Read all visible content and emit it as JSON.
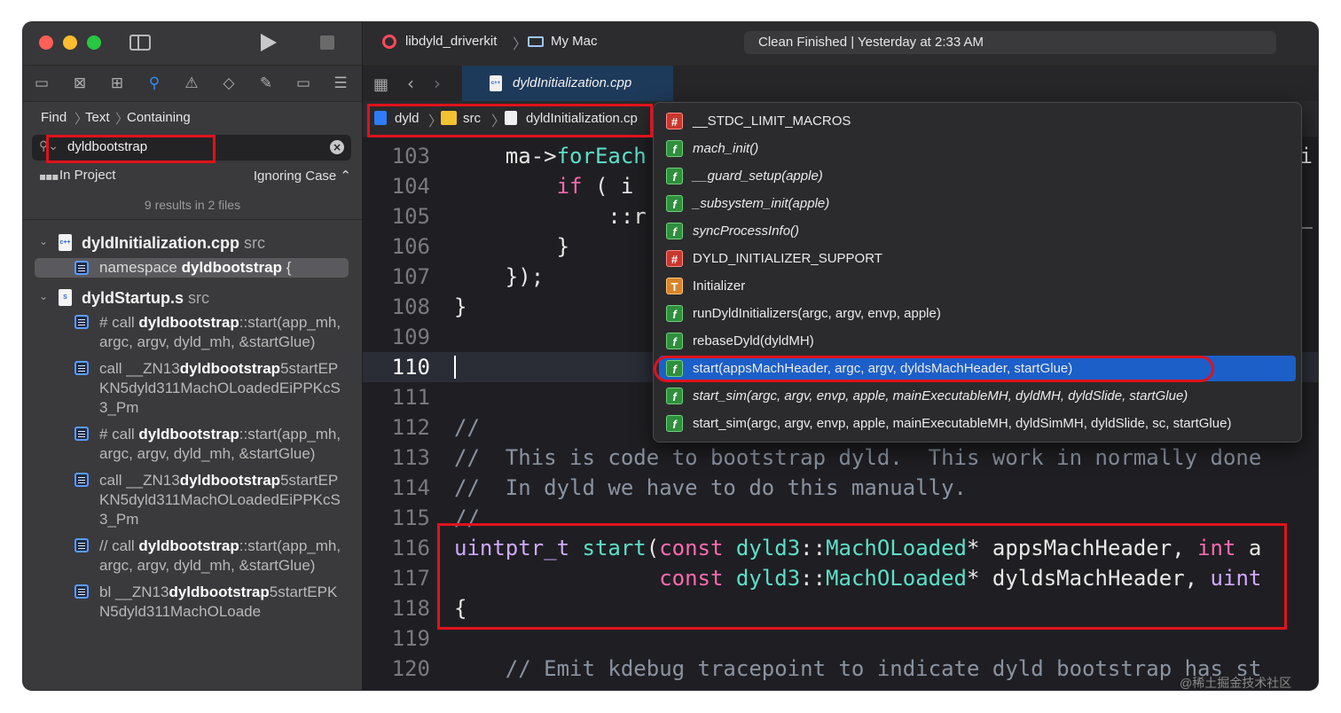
{
  "toolbar": {
    "scheme": "libdyld_driverkit",
    "destination": "My Mac",
    "status": "Clean Finished | Yesterday at 2:33 AM"
  },
  "find": {
    "breadcrumb": [
      "Find",
      "Text",
      "Containing"
    ],
    "query": "dyldbootstrap",
    "scope": "In Project",
    "case_mode": "Ignoring Case ⌃",
    "summary": "9 results in 2 files"
  },
  "results": [
    {
      "file": "dyldInitialization.cpp",
      "dir": "src",
      "file_icon": "c++",
      "matches": [
        {
          "pre": "namespace ",
          "hit": "dyldbootstrap",
          "post": " {",
          "selected": true
        }
      ]
    },
    {
      "file": "dyldStartup.s",
      "dir": "src",
      "file_icon": "S",
      "matches": [
        {
          "pre": "# call ",
          "hit": "dyldbootstrap",
          "post": "::start(app_mh, argc, argv, dyld_mh, &startGlue)"
        },
        {
          "pre": "call   __ZN13",
          "hit": "dyldbootstrap",
          "post": "5startEPKN5dyld311MachOLoadedEiPPKcS3_Pm"
        },
        {
          "pre": "# call ",
          "hit": "dyldbootstrap",
          "post": "::start(app_mh, argc, argv, dyld_mh, &startGlue)"
        },
        {
          "pre": "call   __ZN13",
          "hit": "dyldbootstrap",
          "post": "5startEPKN5dyld311MachOLoadedEiPPKcS3_Pm"
        },
        {
          "pre": "// call ",
          "hit": "dyldbootstrap",
          "post": "::start(app_mh, argc, argv, dyld_mh, &startGlue)"
        },
        {
          "pre": "bl     __ZN13",
          "hit": "dyldbootstrap",
          "post": "5startEPKN5dyld311MachOLoade"
        }
      ]
    }
  ],
  "editor": {
    "tab": "dyldInitialization.cpp",
    "jumpbar": [
      "dyld",
      "src",
      "dyldInitialization.cp"
    ],
    "current_line": "110",
    "lines": [
      {
        "n": "103",
        "t": "    ma->forEach"
      },
      {
        "n": "104",
        "t": "        if ( i"
      },
      {
        "n": "105",
        "t": "            ::r"
      },
      {
        "n": "106",
        "t": "        }"
      },
      {
        "n": "107",
        "t": "    });"
      },
      {
        "n": "108",
        "t": "}"
      },
      {
        "n": "109",
        "t": ""
      },
      {
        "n": "110",
        "t": ""
      },
      {
        "n": "111",
        "t": ""
      },
      {
        "n": "112",
        "t": "//"
      },
      {
        "n": "113",
        "t": "//  This is code to bootstrap dyld.  This work in normally done"
      },
      {
        "n": "114",
        "t": "//  In dyld we have to do this manually."
      },
      {
        "n": "115",
        "t": "//"
      },
      {
        "n": "116",
        "t": "uintptr_t start(const dyld3::MachOLoaded* appsMachHeader, int a"
      },
      {
        "n": "117",
        "t": "                const dyld3::MachOLoaded* dyldsMachHeader, uint"
      },
      {
        "n": "118",
        "t": "{"
      },
      {
        "n": "119",
        "t": ""
      },
      {
        "n": "120",
        "t": "    // Emit kdebug tracepoint to indicate dyld bootstrap has st"
      }
    ],
    "right_edge_105": "e_",
    "right_edge_103": "i"
  },
  "completions": [
    {
      "badge": "#",
      "kind": "macro",
      "label": "__STDC_LIMIT_MACROS",
      "italic": false
    },
    {
      "badge": "f",
      "kind": "function",
      "label": "mach_init()",
      "italic": true
    },
    {
      "badge": "f",
      "kind": "function",
      "label": "__guard_setup(apple)",
      "italic": true
    },
    {
      "badge": "f",
      "kind": "function",
      "label": "_subsystem_init(apple)",
      "italic": true
    },
    {
      "badge": "f",
      "kind": "function",
      "label": "syncProcessInfo()",
      "italic": true
    },
    {
      "badge": "#",
      "kind": "macro",
      "label": "DYLD_INITIALIZER_SUPPORT",
      "italic": false
    },
    {
      "badge": "T",
      "kind": "type",
      "label": "Initializer",
      "italic": false
    },
    {
      "badge": "f",
      "kind": "function",
      "label": "runDyldInitializers(argc, argv, envp, apple)",
      "italic": false
    },
    {
      "badge": "f",
      "kind": "function",
      "label": "rebaseDyld(dyldMH)",
      "italic": false
    },
    {
      "badge": "f",
      "kind": "function",
      "label": "start(appsMachHeader, argc, argv, dyldsMachHeader, startGlue)",
      "italic": false,
      "selected": true
    },
    {
      "badge": "f",
      "kind": "function",
      "label": "start_sim(argc, argv, envp, apple, mainExecutableMH, dyldMH, dyldSlide, startGlue)",
      "italic": true
    },
    {
      "badge": "f",
      "kind": "function",
      "label": "start_sim(argc, argv, envp, apple, mainExecutableMH, dyldSimMH, dyldSlide, sc, startGlue)",
      "italic": false
    }
  ],
  "watermark": "@稀土掘金技术社区",
  "colors": {
    "accent": "#1c5fc9",
    "annotation": "#e0121c",
    "keyword": "#ff6ab0",
    "function": "#5ce0c8",
    "type": "#d0a8ff"
  }
}
